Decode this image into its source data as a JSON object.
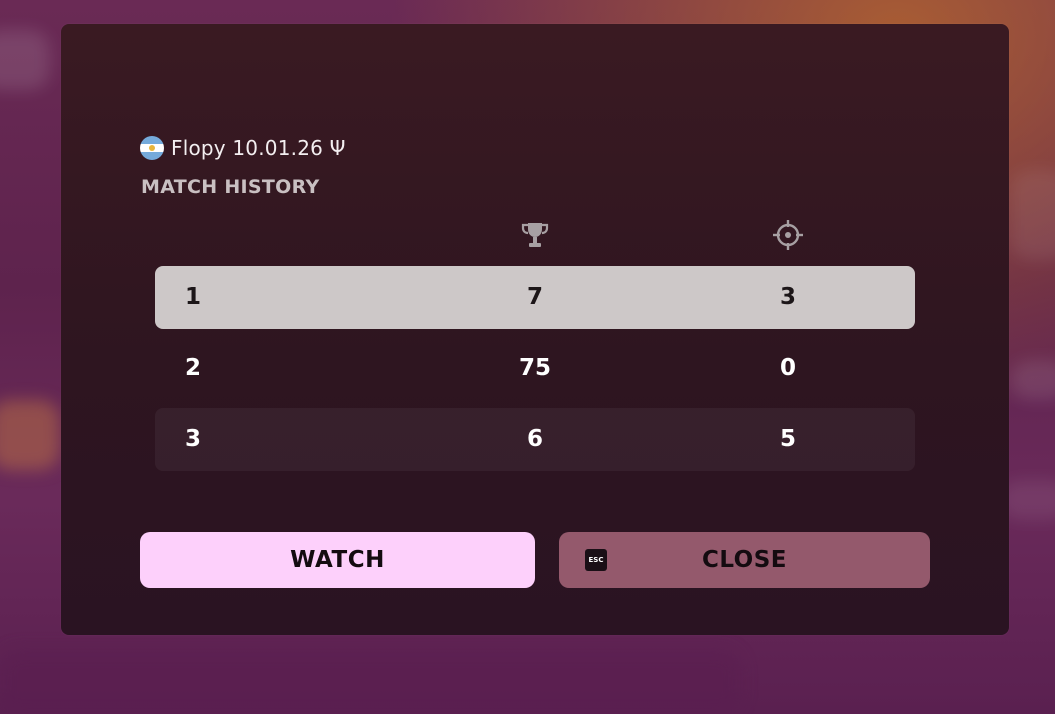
{
  "player": {
    "flag_icon": "argentina-flag-icon",
    "name": "Flopy 10.01.26 Ψ"
  },
  "section_title": "MATCH HISTORY",
  "columns": [
    {
      "icon": "trophy-icon"
    },
    {
      "icon": "crosshair-icon"
    }
  ],
  "rows": [
    {
      "rank": "1",
      "placement": "7",
      "eliminations": "3",
      "selected": true
    },
    {
      "rank": "2",
      "placement": "75",
      "eliminations": "0",
      "selected": false
    },
    {
      "rank": "3",
      "placement": "6",
      "eliminations": "5",
      "selected": false
    }
  ],
  "buttons": {
    "watch_label": "WATCH",
    "close_label": "CLOSE",
    "close_key_hint": "ESC"
  },
  "colors": {
    "selected_row": "#cdc8c8",
    "watch_button": "#fdd0fb",
    "close_button": "#94596c",
    "modal_bg": "#2e1520"
  }
}
